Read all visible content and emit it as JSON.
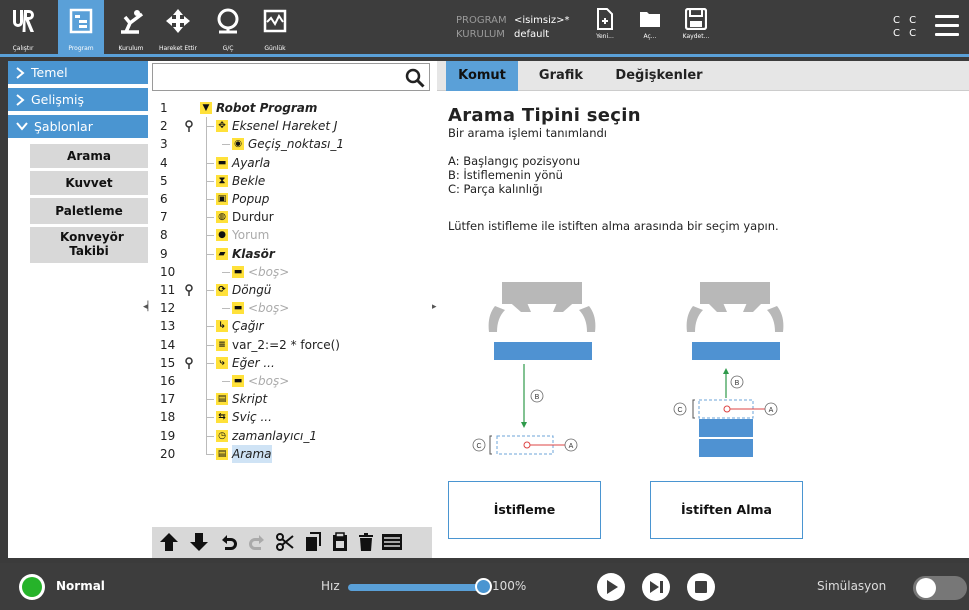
{
  "topbar": {
    "tabs": [
      {
        "label": "Çalıştır",
        "icon": "ur-logo-icon",
        "active": false
      },
      {
        "label": "Program",
        "icon": "program-icon",
        "active": true
      },
      {
        "label": "Kurulum",
        "icon": "installation-icon",
        "active": false
      },
      {
        "label": "Hareket Ettir",
        "icon": "move-icon",
        "active": false
      },
      {
        "label": "G/Ç",
        "icon": "io-icon",
        "active": false
      },
      {
        "label": "Günlük",
        "icon": "log-icon",
        "active": false
      }
    ],
    "program_key": "PROGRAM",
    "program_value": "<isimsiz>*",
    "installation_key": "KURULUM",
    "installation_value": "default",
    "file_buttons": [
      {
        "label": "Yeni...",
        "icon": "new-file-icon"
      },
      {
        "label": "Aç...",
        "icon": "folder-icon"
      },
      {
        "label": "Kaydet...",
        "icon": "save-icon"
      }
    ],
    "cc_row1": "C C",
    "cc_row2": "C C",
    "accent_color": "#5aa0d8"
  },
  "sidebar": {
    "categories": [
      {
        "label": "Temel",
        "expanded": false
      },
      {
        "label": "Gelişmiş",
        "expanded": false
      },
      {
        "label": "Şablonlar",
        "expanded": true
      }
    ],
    "templates": [
      "Arama",
      "Kuvvet",
      "Paletleme",
      "Konveyör Takibi"
    ]
  },
  "tree": {
    "search_value": "",
    "rows": [
      {
        "n": "1",
        "label": "Robot Program",
        "icon": "▼",
        "style": "bi"
      },
      {
        "n": "2",
        "label": "Eksenel Hareket J",
        "icon": "✥",
        "style": "it"
      },
      {
        "n": "3",
        "label": "Geçiş_noktası_1",
        "icon": "◉",
        "style": "it"
      },
      {
        "n": "4",
        "label": "Ayarla",
        "icon": "▬",
        "style": "it"
      },
      {
        "n": "5",
        "label": "Bekle",
        "icon": "⧗",
        "style": "it"
      },
      {
        "n": "6",
        "label": "Popup",
        "icon": "▣",
        "style": "it"
      },
      {
        "n": "7",
        "label": "Durdur",
        "icon": "◍",
        "style": "n"
      },
      {
        "n": "8",
        "label": "Yorum",
        "icon": "●",
        "style": "grayn"
      },
      {
        "n": "9",
        "label": "Klasör",
        "icon": "▰",
        "style": "bi"
      },
      {
        "n": "10",
        "label": "<boş>",
        "icon": "▬",
        "style": "gray"
      },
      {
        "n": "11",
        "label": "Döngü",
        "icon": "⟳",
        "style": "it"
      },
      {
        "n": "12",
        "label": "<boş>",
        "icon": "▬",
        "style": "gray"
      },
      {
        "n": "13",
        "label": "Çağır",
        "icon": "↳",
        "style": "it"
      },
      {
        "n": "14",
        "label": "var_2:=2 * force()",
        "icon": "≡",
        "style": "n"
      },
      {
        "n": "15",
        "label": "Eğer ...",
        "icon": "⤷",
        "style": "it"
      },
      {
        "n": "16",
        "label": "<boş>",
        "icon": "▬",
        "style": "gray"
      },
      {
        "n": "17",
        "label": "Skript",
        "icon": "▤",
        "style": "it"
      },
      {
        "n": "18",
        "label": "Sviç ...",
        "icon": "⇆",
        "style": "it"
      },
      {
        "n": "19",
        "label": "zamanlayıcı_1",
        "icon": "◷",
        "style": "it"
      },
      {
        "n": "20",
        "label": "Arama",
        "icon": "▤",
        "style": "it"
      }
    ],
    "toolbar": [
      "move-up-icon",
      "move-down-icon",
      "undo-icon",
      "redo-icon",
      "cut-icon",
      "copy-icon",
      "paste-icon",
      "delete-icon",
      "suppress-icon"
    ]
  },
  "right": {
    "tabs": [
      {
        "label": "Komut",
        "active": true
      },
      {
        "label": "Grafik",
        "active": false
      },
      {
        "label": "Değişkenler",
        "active": false
      }
    ],
    "title": "Arama Tipini seçin",
    "subtitle": "Bir arama işlemi tanımlandı",
    "line_a": "A: Başlangıç pozisyonu",
    "line_b": "B: İstiflemenin yönü",
    "line_c": "C: Parça kalınlığı",
    "prompt": "Lütfen istifleme ile istiften alma arasında bir seçim yapın.",
    "marker_a": "A",
    "marker_b": "B",
    "marker_c": "C",
    "button_stack": "İstifleme",
    "button_destack": "İstiften Alma"
  },
  "bottombar": {
    "status": "Normal",
    "speed_label": "Hız",
    "speed_value": "100%",
    "speed": 100,
    "simulation_label": "Simülasyon",
    "status_color": "#26b32a"
  }
}
